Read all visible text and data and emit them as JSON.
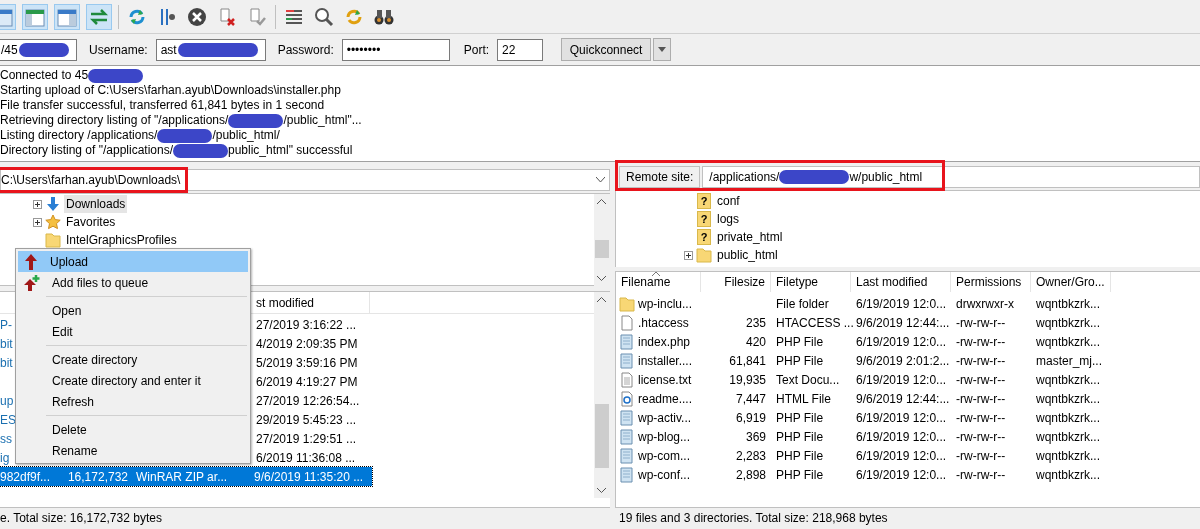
{
  "quickconnect": {
    "host": {
      "value": "/45",
      "redacted": true
    },
    "username": {
      "label": "Username:",
      "value": "ast",
      "redacted": true
    },
    "password": {
      "label": "Password:",
      "value": "••••••••"
    },
    "port": {
      "label": "Port:",
      "value": "22"
    },
    "button": "Quickconnect"
  },
  "log": [
    {
      "text": "Connected to 45",
      "redacted": true
    },
    {
      "text": "Starting upload of C:\\Users\\farhan.ayub\\Downloads\\installer.php",
      "redacted": false
    },
    {
      "text": "File transfer successful, transferred 61,841 bytes in 1 second",
      "redacted": false
    },
    {
      "text": "Retrieving directory listing of \"/applications/",
      "redacted": true,
      "rest": "/public_html\"..."
    },
    {
      "text": "Listing directory /applications/",
      "redacted": true,
      "rest": "/public_html/"
    },
    {
      "text": "Directory listing of \"/applications/",
      "redacted": true,
      "rest": "public_html\" successful"
    }
  ],
  "local": {
    "path": {
      "value": "C:\\Users\\farhan.ayub\\Downloads\\",
      "highlighted": true
    },
    "tree": [
      {
        "name": "Downloads",
        "kind": "download",
        "expandable": true,
        "selected": true
      },
      {
        "name": "Favorites",
        "kind": "star",
        "expandable": true,
        "selected": false
      },
      {
        "name": "IntelGraphicsProfiles",
        "kind": "folder",
        "expandable": false,
        "selected": false
      }
    ],
    "header": "st modified",
    "rows": [
      {
        "kind": "partial",
        "name": "P-",
        "modified": "27/2019 3:16:22 ...",
        "selected": false
      },
      {
        "kind": "partial",
        "name": "bit",
        "modified": "4/2019 2:09:35 PM",
        "selected": false
      },
      {
        "kind": "partial",
        "name": "bit",
        "modified": "5/2019 3:59:16 PM",
        "selected": false
      },
      {
        "kind": "partial",
        "modified": "6/2019 4:19:27 PM",
        "selected": false
      },
      {
        "kind": "partial",
        "name": "up",
        "modified": "27/2019 12:26:54...",
        "selected": false
      },
      {
        "kind": "partial",
        "name": "ES",
        "modified": "29/2019 5:45:23 ...",
        "selected": false
      },
      {
        "kind": "partial",
        "name": "ss",
        "modified": "27/2019 1:29:51 ...",
        "selected": false
      },
      {
        "kind": "partial",
        "name": "ig",
        "modified": "6/2019 11:36:08 ...",
        "selected": false
      },
      {
        "kind": "full",
        "name": "982df9f...",
        "size": "16,172,732",
        "type": "WinRAR ZIP ar...",
        "modified": "9/6/2019 11:35:20 ...",
        "selected": true
      }
    ],
    "status": "e. Total size: 16,172,732 bytes"
  },
  "context_menu": [
    {
      "kind": "upload",
      "label": "Upload",
      "selected": true
    },
    {
      "kind": "queue",
      "label": "Add files to queue",
      "selected": false
    },
    {
      "kind": "separator"
    },
    {
      "kind": "item",
      "label": "Open",
      "selected": false
    },
    {
      "kind": "item",
      "label": "Edit",
      "selected": false
    },
    {
      "kind": "separator"
    },
    {
      "kind": "item",
      "label": "Create directory",
      "selected": false
    },
    {
      "kind": "item",
      "label": "Create directory and enter it",
      "selected": false
    },
    {
      "kind": "item",
      "label": "Refresh",
      "selected": false
    },
    {
      "kind": "separator"
    },
    {
      "kind": "item",
      "label": "Delete",
      "selected": false
    },
    {
      "kind": "item",
      "label": "Rename",
      "selected": false
    }
  ],
  "remote": {
    "path": {
      "label": "Remote site:",
      "value": "/applications/",
      "rest": "w/public_html",
      "redacted": true,
      "highlighted": true
    },
    "tree": [
      {
        "name": "conf",
        "kind": "unknown",
        "badge": "?",
        "expandable": false
      },
      {
        "name": "logs",
        "kind": "unknown",
        "badge": "?",
        "expandable": false
      },
      {
        "name": "private_html",
        "kind": "unknown",
        "badge": "?",
        "expandable": false
      },
      {
        "name": "public_html",
        "kind": "folder",
        "expandable": true
      }
    ],
    "columns": [
      "Filename",
      "Filesize",
      "Filetype",
      "Last modified",
      "Permissions",
      "Owner/Gro..."
    ],
    "rows": [
      {
        "kind": "folder",
        "cells": [
          "wp-inclu...",
          "",
          "File folder",
          "6/19/2019 12:0...",
          "drwxrwxr-x",
          "wqntbkzrk..."
        ]
      },
      {
        "kind": "blank",
        "cells": [
          ".htaccess",
          "235",
          "HTACCESS ...",
          "9/6/2019 12:44:...",
          "-rw-rw-r--",
          "wqntbkzrk..."
        ]
      },
      {
        "kind": "php",
        "cells": [
          "index.php",
          "420",
          "PHP File",
          "6/19/2019 12:0...",
          "-rw-rw-r--",
          "wqntbkzrk..."
        ]
      },
      {
        "kind": "php",
        "cells": [
          "installer....",
          "61,841",
          "PHP File",
          "9/6/2019 2:01:2...",
          "-rw-rw-r--",
          "master_mj..."
        ]
      },
      {
        "kind": "text",
        "cells": [
          "license.txt",
          "19,935",
          "Text Docu...",
          "6/19/2019 12:0...",
          "-rw-rw-r--",
          "wqntbkzrk..."
        ]
      },
      {
        "kind": "html",
        "cells": [
          "readme....",
          "7,447",
          "HTML File",
          "9/6/2019 12:44:...",
          "-rw-rw-r--",
          "wqntbkzrk..."
        ]
      },
      {
        "kind": "php",
        "cells": [
          "wp-activ...",
          "6,919",
          "PHP File",
          "6/19/2019 12:0...",
          "-rw-rw-r--",
          "wqntbkzrk..."
        ]
      },
      {
        "kind": "php",
        "cells": [
          "wp-blog...",
          "369",
          "PHP File",
          "6/19/2019 12:0...",
          "-rw-rw-r--",
          "wqntbkzrk..."
        ]
      },
      {
        "kind": "php",
        "cells": [
          "wp-com...",
          "2,283",
          "PHP File",
          "6/19/2019 12:0...",
          "-rw-rw-r--",
          "wqntbkzrk..."
        ]
      },
      {
        "kind": "php",
        "cells": [
          "wp-conf...",
          "2,898",
          "PHP File",
          "6/19/2019 12:0...",
          "-rw-rw-r--",
          "wqntbkzrk..."
        ]
      }
    ],
    "status": "19 files and 3 directories. Total size: 218,968 bytes"
  }
}
